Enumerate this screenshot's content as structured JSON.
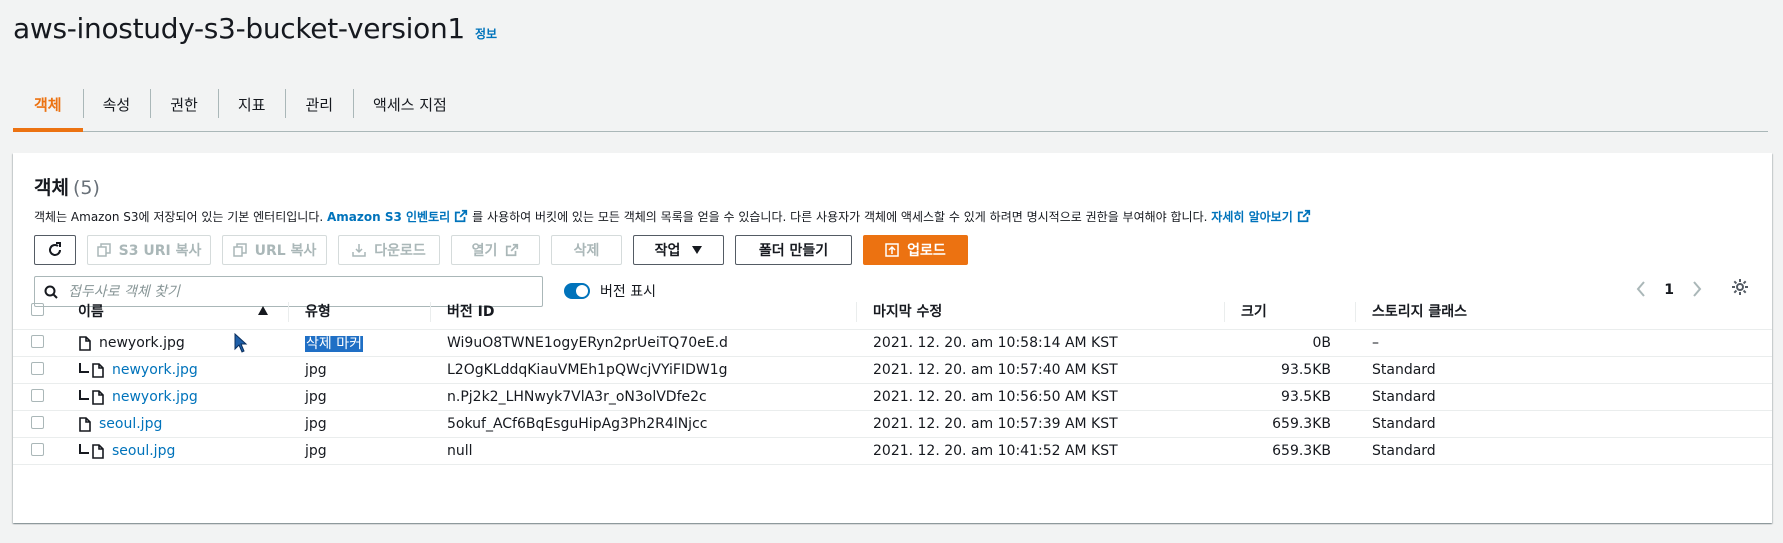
{
  "header": {
    "title": "aws-inostudy-s3-bucket-version1",
    "info": "정보"
  },
  "tabs": [
    {
      "label": "객체",
      "active": true
    },
    {
      "label": "속성"
    },
    {
      "label": "권한"
    },
    {
      "label": "지표"
    },
    {
      "label": "관리"
    },
    {
      "label": "액세스 지점"
    }
  ],
  "panel": {
    "title": "객체",
    "count": "(5)",
    "desc_1": "객체는 Amazon S3에 저장되어 있는 기본 엔터티입니다. ",
    "desc_link_1": "Amazon S3 인벤토리",
    "desc_2": "를 사용하여 버킷에 있는 모든 객체의 목록을 얻을 수 있습니다. 다른 사용자가 객체에 액세스할 수 있게 하려면 명시적으로 권한을 부여해야 합니다. ",
    "desc_link_2": "자세히 알아보기"
  },
  "toolbar": {
    "copy_s3_uri": "S3 URI 복사",
    "copy_url": "URL 복사",
    "download": "다운로드",
    "open": "열기",
    "delete": "삭제",
    "actions": "작업",
    "create_folder": "폴더 만들기",
    "upload": "업로드"
  },
  "search": {
    "placeholder": "접두사로 객체 찾기"
  },
  "show_versions": {
    "label": "버전 표시",
    "on": true
  },
  "pagination": {
    "page": "1"
  },
  "table": {
    "headers": [
      "이름",
      "유형",
      "버전 ID",
      "마지막 수정",
      "크기",
      "스토리지 클래스"
    ],
    "rows": [
      {
        "name": "newyork.jpg",
        "type": "삭제 마커",
        "version": "Wi9uO8TWNE1ogyERyn2prUeiTQ70eE.d",
        "modified": "2021. 12. 20. am 10:58:14 AM KST",
        "size": "0B",
        "storage": "–",
        "child": false,
        "link": false,
        "highlight": true
      },
      {
        "name": "newyork.jpg",
        "type": "jpg",
        "version": "L2OgKLddqKiauVMEh1pQWcjVYiFIDW1g",
        "modified": "2021. 12. 20. am 10:57:40 AM KST",
        "size": "93.5KB",
        "storage": "Standard",
        "child": true,
        "link": true
      },
      {
        "name": "newyork.jpg",
        "type": "jpg",
        "version": "n.Pj2k2_LHNwyk7VlA3r_oN3olVDfe2c",
        "modified": "2021. 12. 20. am 10:56:50 AM KST",
        "size": "93.5KB",
        "storage": "Standard",
        "child": true,
        "link": true
      },
      {
        "name": "seoul.jpg",
        "type": "jpg",
        "version": "5okuf_ACf6BqEsguHipAg3Ph2R4lNjcc",
        "modified": "2021. 12. 20. am 10:57:39 AM KST",
        "size": "659.3KB",
        "storage": "Standard",
        "child": false,
        "link": true
      },
      {
        "name": "seoul.jpg",
        "type": "jpg",
        "version": "null",
        "modified": "2021. 12. 20. am 10:41:52 AM KST",
        "size": "659.3KB",
        "storage": "Standard",
        "child": true,
        "link": true
      }
    ]
  },
  "colors": {
    "accent": "#ec7211",
    "link": "#0073bb",
    "selection": "#1f6fc5"
  }
}
